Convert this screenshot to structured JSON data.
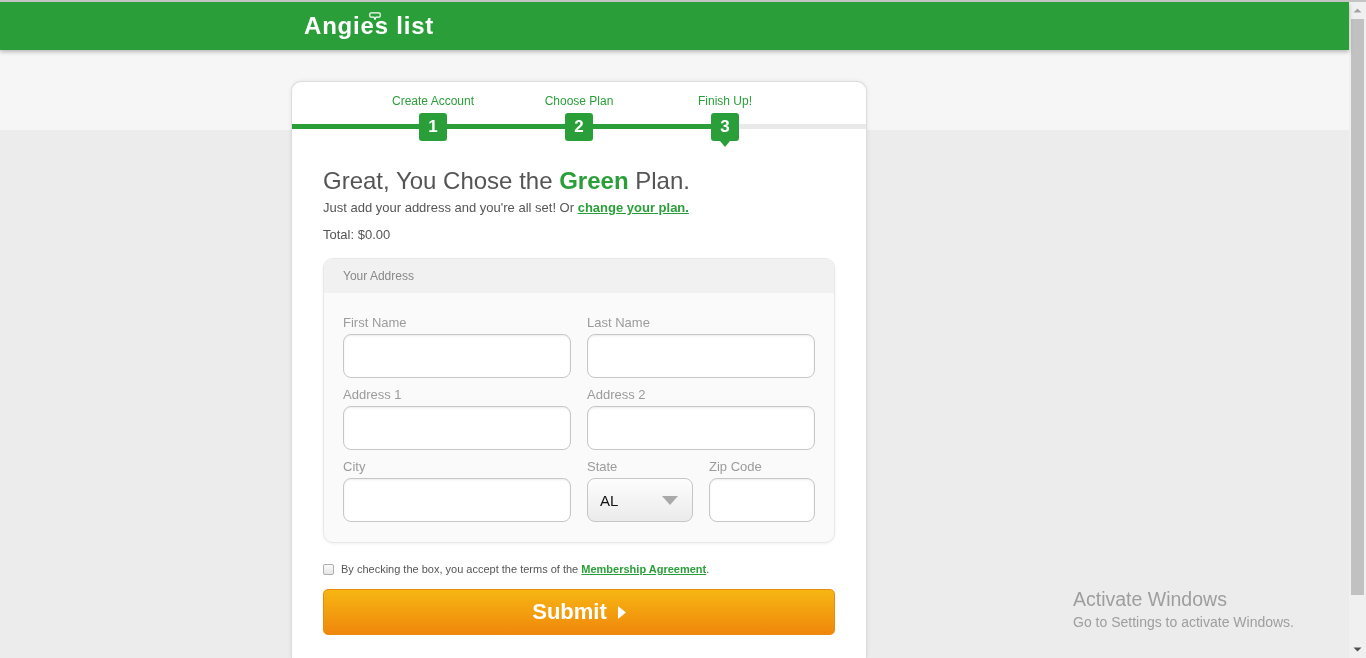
{
  "header": {
    "logo": "Angies list"
  },
  "steps": [
    {
      "label": "Create Account",
      "number": "1",
      "selected": false
    },
    {
      "label": "Choose Plan",
      "number": "2",
      "selected": false
    },
    {
      "label": "Finish Up!",
      "number": "3",
      "selected": true
    }
  ],
  "heading": "Great, You Chose the **Green** Plan.",
  "intro": {
    "text": "Just add your address and you're all set! Or",
    "link": "change your plan."
  },
  "total": "Total: $0.00",
  "address_panel": {
    "title": "Your Address",
    "rows": [
      [
        {
          "kind": "text",
          "label": "First Name"
        },
        {
          "kind": "text",
          "label": "Last Name"
        }
      ],
      [
        {
          "kind": "text",
          "label": "Address 1"
        },
        {
          "kind": "text",
          "label": "Address 2"
        }
      ],
      [
        {
          "kind": "text",
          "label": "City"
        },
        {
          "kind": "select",
          "label": "State",
          "value": "AL"
        },
        {
          "kind": "text",
          "label": "Zip Code"
        }
      ]
    ]
  },
  "agreement": {
    "checked": false,
    "text": "By checking the box, you accept the terms of the",
    "link": "Membership Agreement",
    "suffix": "."
  },
  "submit_button": {
    "label": "Submit"
  },
  "os_overlay": {
    "title": "Activate Windows",
    "subtitle": "Go to Settings to activate Windows."
  }
}
